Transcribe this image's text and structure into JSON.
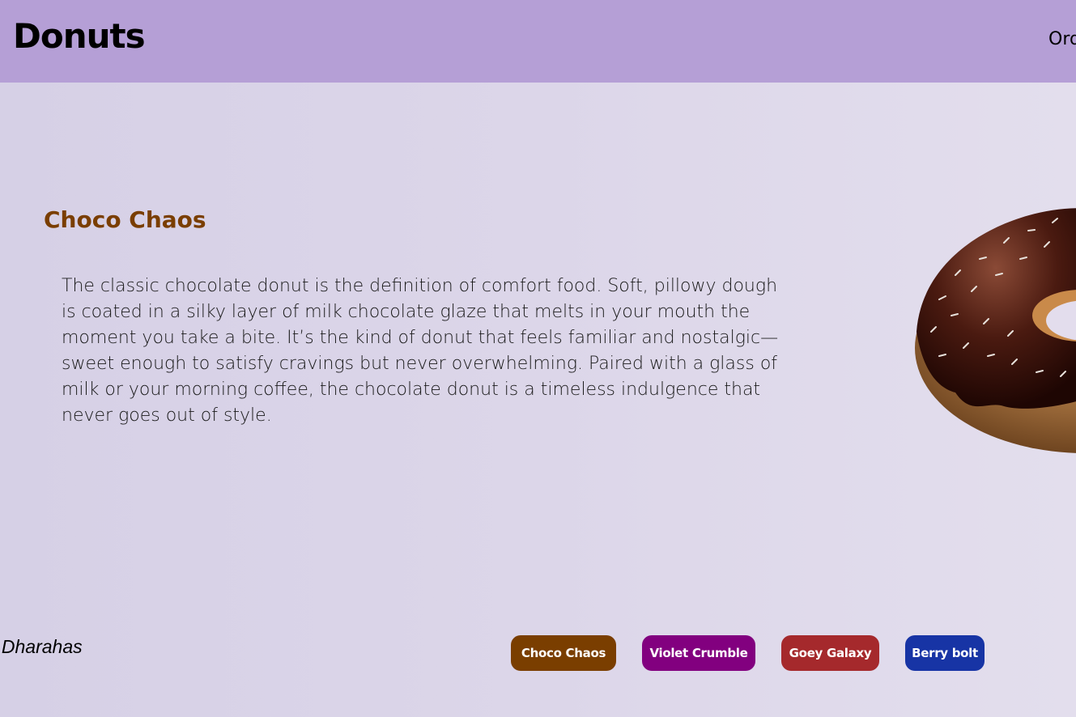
{
  "header": {
    "logo": "Donuts",
    "nav_partial": "Ord"
  },
  "product": {
    "title": "Choco Chaos",
    "title_color": "#7a3e00",
    "description": "The classic chocolate donut is the definition of comfort food. Soft, pillowy dough is coated in a silky layer of milk chocolate glaze that melts in your mouth the moment you take a bite. It’s the kind of donut that feels familiar and nostalgic—sweet enough to satisfy cravings but never overwhelming. Paired with a glass of milk or your morning coffee, the chocolate donut is a timeless indulgence that never goes out of style.",
    "image": "chocolate-donut-with-sprinkles"
  },
  "footer": {
    "credit": "y Dharahas"
  },
  "flavors": [
    {
      "label": "Choco Chaos",
      "color": "#7a3e00"
    },
    {
      "label": "Violet Crumble",
      "color": "#82007f"
    },
    {
      "label": "Goey Galaxy",
      "color": "#a5292c"
    },
    {
      "label": "Berry bolt",
      "color": "#1734a5"
    }
  ]
}
